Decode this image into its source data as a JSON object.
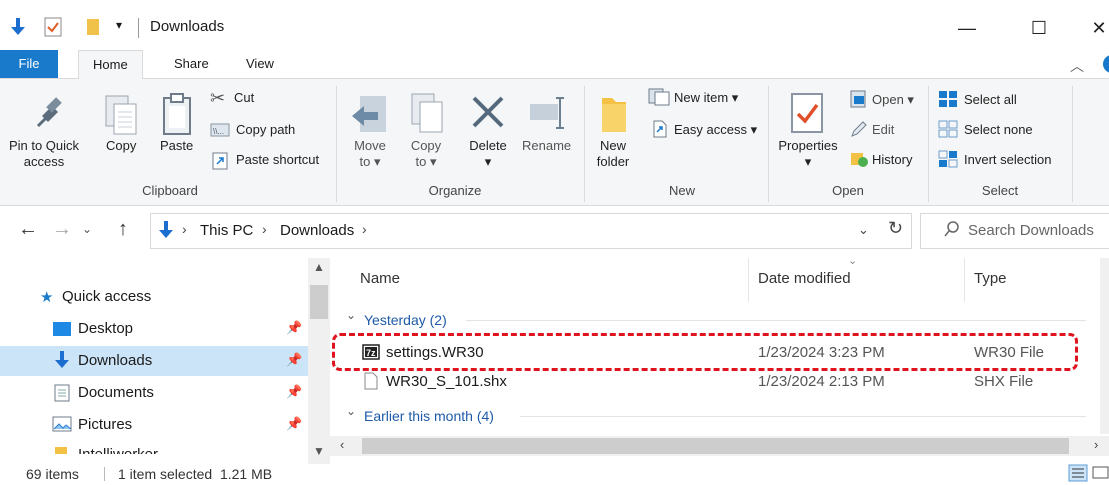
{
  "window": {
    "title": "Downloads",
    "minimize": "—",
    "maximize": "☐",
    "close": "✕"
  },
  "ribbon": {
    "tabs": [
      "File",
      "Home",
      "Share",
      "View"
    ],
    "clipboard": {
      "pin": "Pin to Quick",
      "pin2": "access",
      "copy": "Copy",
      "paste": "Paste",
      "cut": "Cut",
      "copy_path": "Copy path",
      "paste_shortcut": "Paste shortcut",
      "group": "Clipboard"
    },
    "organize": {
      "move": "Move",
      "move2": "to ▾",
      "copy": "Copy",
      "copy2": "to ▾",
      "delete": "Delete",
      "delete2": "▾",
      "rename": "Rename",
      "group": "Organize"
    },
    "new": {
      "folder": "New",
      "folder2": "folder",
      "new_item": "New item ▾",
      "easy_access": "Easy access ▾",
      "group": "New"
    },
    "open": {
      "properties": "Properties",
      "properties2": "▾",
      "open": "Open ▾",
      "edit": "Edit",
      "history": "History",
      "group": "Open"
    },
    "select": {
      "select_all": "Select all",
      "select_none": "Select none",
      "invert": "Invert selection",
      "group": "Select"
    }
  },
  "address": {
    "path_root": "This PC",
    "path_leaf": "Downloads",
    "search_placeholder": "Search Downloads"
  },
  "nav": {
    "quick_access": "Quick access",
    "items": [
      "Desktop",
      "Downloads",
      "Documents",
      "Pictures",
      "Intelliworker"
    ]
  },
  "columns": {
    "name": "Name",
    "date": "Date modified",
    "type": "Type"
  },
  "groups": {
    "yesterday": "Yesterday (2)",
    "earlier": "Earlier this month (4)"
  },
  "files": [
    {
      "name": "settings.WR30",
      "date": "1/23/2024 3:23 PM",
      "type": "WR30 File"
    },
    {
      "name": "WR30_S_101.shx",
      "date": "1/23/2024 2:13 PM",
      "type": "SHX File"
    }
  ],
  "status": {
    "items": "69 items",
    "selected": "1 item selected  1.21 MB"
  }
}
